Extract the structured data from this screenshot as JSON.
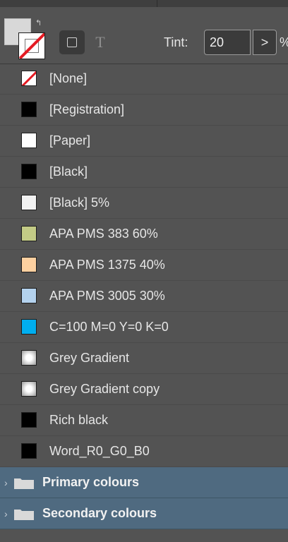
{
  "toolbar": {
    "tint_label": "Tint:",
    "tint_value": "20",
    "tint_percent": "%",
    "text_mode_glyph": "T",
    "arrow_glyph": ">"
  },
  "swatches": [
    {
      "label": "[None]",
      "color": "#ffffff",
      "type": "none"
    },
    {
      "label": "[Registration]",
      "color": "#000000",
      "type": "solid"
    },
    {
      "label": "[Paper]",
      "color": "#ffffff",
      "type": "solid"
    },
    {
      "label": "[Black]",
      "color": "#000000",
      "type": "solid"
    },
    {
      "label": "[Black] 5%",
      "color": "#f2f2f2",
      "type": "solid"
    },
    {
      "label": "APA PMS 383 60%",
      "color": "#c3cb86",
      "type": "solid"
    },
    {
      "label": "APA PMS 1375 40%",
      "color": "#fdd0a0",
      "type": "solid"
    },
    {
      "label": "APA PMS 3005 30%",
      "color": "#b4d2ee",
      "type": "solid"
    },
    {
      "label": "C=100 M=0 Y=0 K=0",
      "color": "#00aeef",
      "type": "solid"
    },
    {
      "label": "Grey Gradient",
      "color": "#ffffff",
      "type": "gradient"
    },
    {
      "label": "Grey Gradient copy",
      "color": "#ffffff",
      "type": "gradient"
    },
    {
      "label": "Rich black",
      "color": "#000000",
      "type": "solid"
    },
    {
      "label": "Word_R0_G0_B0",
      "color": "#000000",
      "type": "solid"
    }
  ],
  "groups": [
    {
      "label": "Primary colours",
      "icon": "folder-icon"
    },
    {
      "label": "Secondary colours",
      "icon": "folder-icon"
    }
  ]
}
